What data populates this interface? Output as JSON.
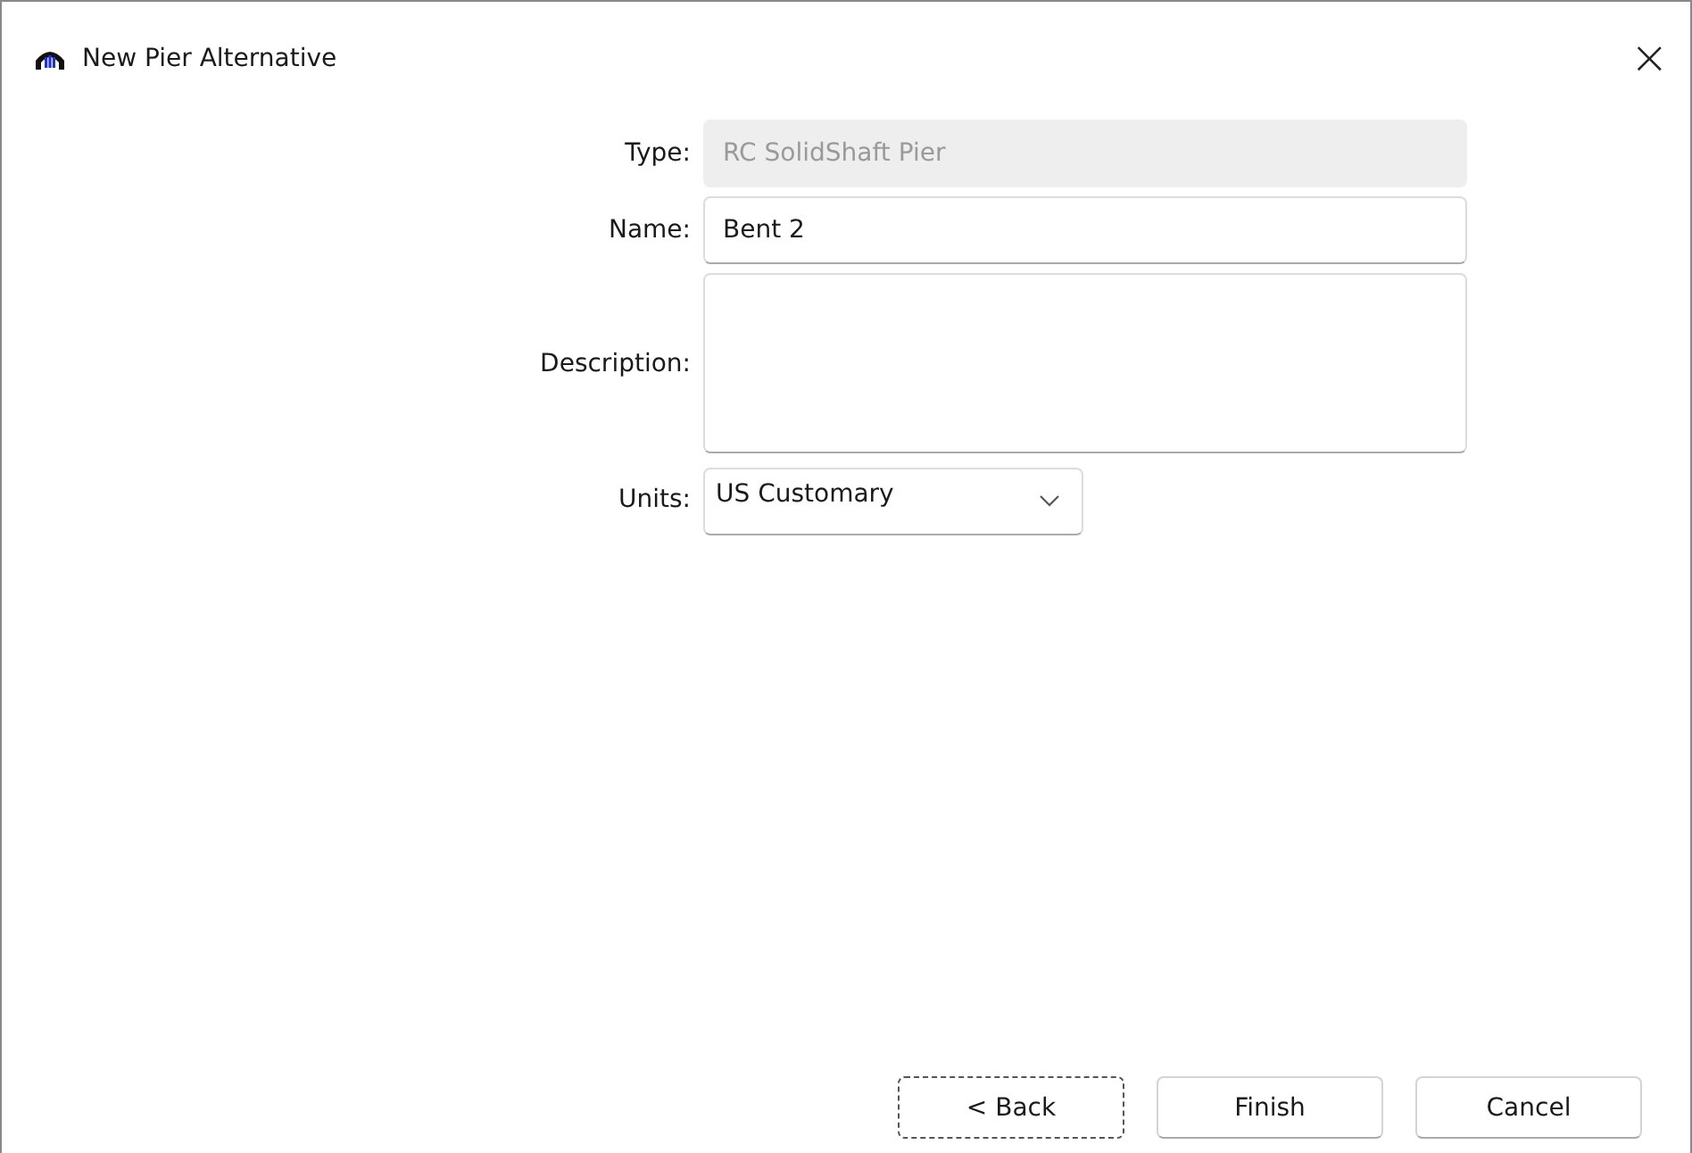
{
  "window": {
    "title": "New Pier Alternative",
    "close": "×"
  },
  "form": [
    {
      "kind": "text",
      "label": "Type:",
      "value": "RC SolidShaft Pier",
      "disabled": true
    },
    {
      "kind": "text",
      "label": "Name:",
      "value": "Bent 2",
      "disabled": false
    },
    {
      "kind": "textarea",
      "label": "Description:",
      "disabled": false
    },
    {
      "kind": "select",
      "label": "Units:",
      "value": "US Customary",
      "disabled": false
    }
  ],
  "buttons": [
    {
      "label": "< Back",
      "focused": true
    },
    {
      "label": "Finish",
      "focused": false
    },
    {
      "label": "Cancel",
      "focused": false
    }
  ]
}
